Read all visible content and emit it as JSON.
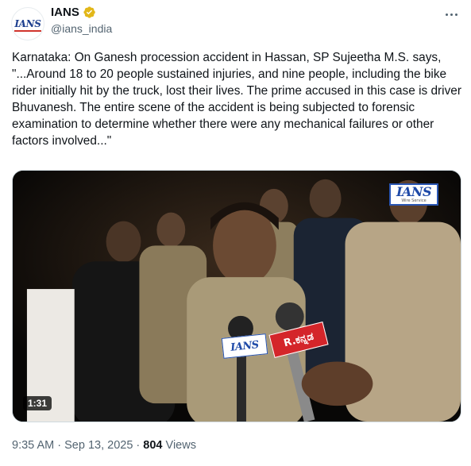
{
  "account": {
    "avatar_logo": "IANS",
    "display_name": "IANS",
    "handle": "@ians_india",
    "verified": true,
    "verified_color": "#e2b719"
  },
  "tweet": {
    "text": "Karnataka: On Ganesh procession accident in Hassan, SP Sujeetha M.S. says, \"...Around 18 to 20 people sustained injuries, and nine people, including the bike rider initially hit by the truck, lost their lives. The prime accused in this case is driver Bhuvanesh. The entire scene of the accident is being subjected to forensic examination to determine whether there were any mechanical failures or other factors involved...\""
  },
  "media": {
    "watermark": "IANS",
    "watermark_sub": "Wire Service",
    "mic_label_1": "IANS",
    "mic_label_2": "R.ಕನ್ನಡ",
    "duration": "1:31"
  },
  "meta": {
    "time": "9:35 AM",
    "separator": "·",
    "date": "Sep 13, 2025",
    "views_count": "804",
    "views_label": "Views"
  },
  "icons": {
    "more": "more-options-icon",
    "verified": "verified-badge-icon"
  }
}
